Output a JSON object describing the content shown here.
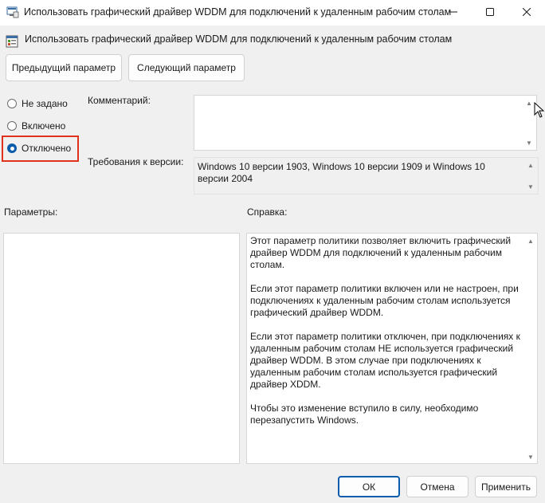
{
  "window": {
    "title": "Использовать графический драйвер WDDM для подключений к удаленным рабочим столам"
  },
  "header": {
    "title": "Использовать графический драйвер WDDM для подключений к удаленным рабочим столам"
  },
  "nav": {
    "prev_label": "Предыдущий параметр",
    "next_label": "Следующий параметр"
  },
  "state": {
    "options": [
      "Не задано",
      "Включено",
      "Отключено"
    ],
    "selected": "Отключено"
  },
  "comment": {
    "label": "Комментарий:",
    "value": ""
  },
  "version": {
    "label": "Требования к версии:",
    "value": "Windows 10 версии 1903, Windows 10 версии 1909 и Windows 10 версии 2004"
  },
  "params": {
    "label": "Параметры:"
  },
  "help": {
    "label": "Справка:",
    "paragraphs": [
      "Этот параметр политики позволяет включить графический драйвер WDDM для подключений к удаленным рабочим столам.",
      "Если этот параметр политики включен или не настроен, при подключениях к удаленным рабочим столам используется графический драйвер WDDM.",
      "Если этот параметр политики отключен, при подключениях к удаленным рабочим столам НЕ используется графический драйвер WDDM. В этом случае при подключениях к удаленным рабочим столам используется графический драйвер XDDM.",
      "Чтобы это изменение вступило в силу, необходимо перезапустить Windows."
    ]
  },
  "footer": {
    "ok_label": "ОК",
    "cancel_label": "Отмена",
    "apply_label": "Применить"
  },
  "icons": {
    "title": "policy-window-icon",
    "header": "policy-setting-icon",
    "minimize": "minimize-icon",
    "maximize": "maximize-icon",
    "close": "close-icon"
  },
  "colors": {
    "accent": "#0b5cad",
    "highlight": "#e0301e"
  }
}
